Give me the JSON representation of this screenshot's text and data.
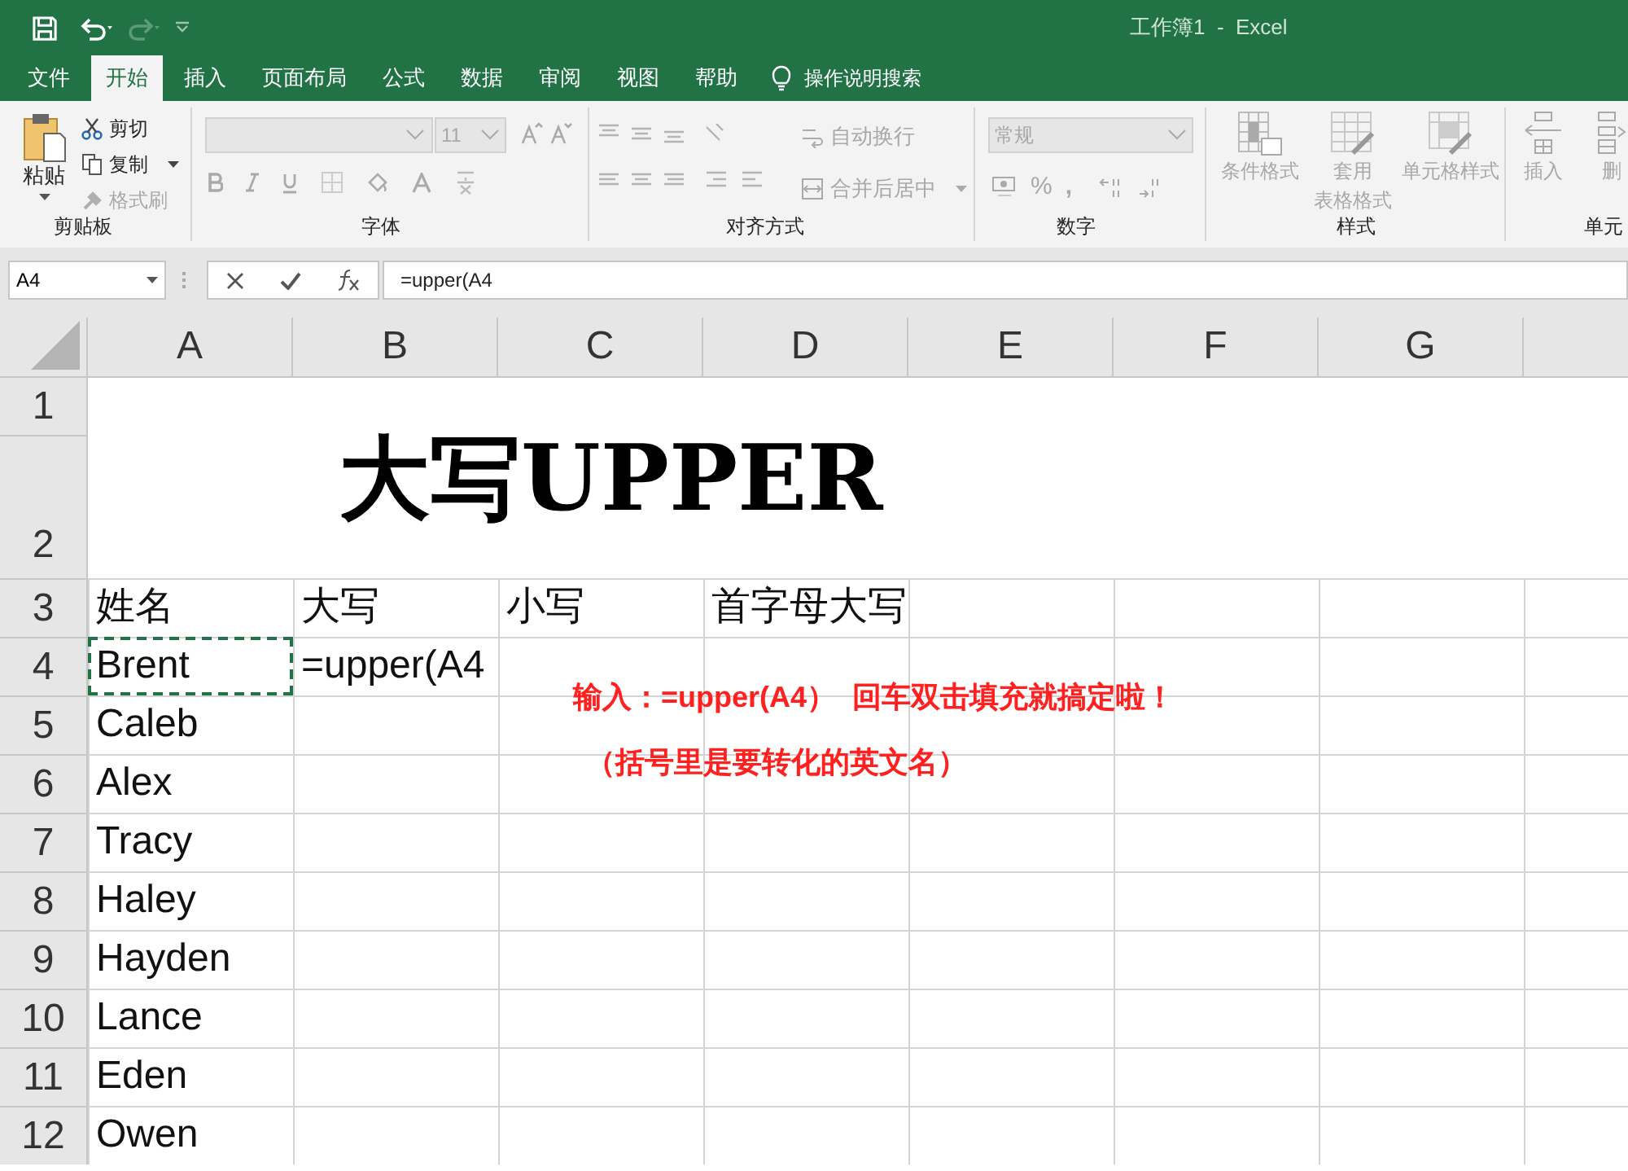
{
  "title_bar": {
    "title": "工作簿1  -  Excel"
  },
  "tabs": [
    {
      "label": "文件",
      "selected": false
    },
    {
      "label": "开始",
      "selected": true
    },
    {
      "label": "插入",
      "selected": false
    },
    {
      "label": "页面布局",
      "selected": false
    },
    {
      "label": "公式",
      "selected": false
    },
    {
      "label": "数据",
      "selected": false
    },
    {
      "label": "审阅",
      "selected": false
    },
    {
      "label": "视图",
      "selected": false
    },
    {
      "label": "帮助",
      "selected": false
    }
  ],
  "tell_me": "操作说明搜索",
  "ribbon": {
    "clipboard": {
      "paste": "粘贴",
      "cut": {
        "label": "剪切",
        "disabled": false
      },
      "copy": {
        "label": "复制",
        "disabled": false
      },
      "format_painter": {
        "label": "格式刷",
        "disabled": true
      },
      "group_label": "剪贴板"
    },
    "font": {
      "disabled": true,
      "font_size": "11",
      "group_label": "字体"
    },
    "alignment": {
      "disabled": true,
      "wrap_text": "自动换行",
      "merge_center": "合并后居中",
      "group_label": "对齐方式"
    },
    "number": {
      "disabled": true,
      "format": "常规",
      "percent": "%",
      "comma": ",",
      "group_label": "数字"
    },
    "styles": {
      "disabled": true,
      "conditional_formatting": "条件格式",
      "format_as_table_1": "套用",
      "format_as_table_2": "表格格式",
      "cell_styles": "单元格样式",
      "group_label": "样式"
    },
    "cells": {
      "disabled": true,
      "insert": "插入",
      "delete": "删",
      "group_label": "单元"
    }
  },
  "formula_bar": {
    "name_box": "A4",
    "formula": "=upper(A4"
  },
  "sheet": {
    "columns": [
      "A",
      "B",
      "C",
      "D",
      "E",
      "F",
      "G"
    ],
    "title": "大写UPPER",
    "row_numbers_merged": [
      "1",
      "2"
    ],
    "rows": [
      {
        "number": "3",
        "cells": [
          {
            "text": "姓名",
            "marquee": false
          },
          {
            "text": "大写",
            "marquee": false
          },
          {
            "text": "小写",
            "marquee": false
          },
          {
            "text": "首字母大写",
            "marquee": false
          }
        ]
      },
      {
        "number": "4",
        "cells": [
          {
            "text": "Brent",
            "marquee": true
          },
          {
            "text": "=upper(A4",
            "marquee": false
          }
        ]
      },
      {
        "number": "5",
        "cells": [
          {
            "text": "Caleb",
            "marquee": false
          }
        ]
      },
      {
        "number": "6",
        "cells": [
          {
            "text": "Alex",
            "marquee": false
          }
        ]
      },
      {
        "number": "7",
        "cells": [
          {
            "text": "Tracy",
            "marquee": false
          }
        ]
      },
      {
        "number": "8",
        "cells": [
          {
            "text": "Haley",
            "marquee": false
          }
        ]
      },
      {
        "number": "9",
        "cells": [
          {
            "text": "Hayden",
            "marquee": false
          }
        ]
      },
      {
        "number": "10",
        "cells": [
          {
            "text": "Lance",
            "marquee": false
          }
        ]
      },
      {
        "number": "11",
        "cells": [
          {
            "text": "Eden",
            "marquee": false
          }
        ]
      },
      {
        "number": "12",
        "cells": [
          {
            "text": "Owen",
            "marquee": false
          }
        ]
      }
    ],
    "annotations": [
      "输入：=upper(A4）  回车双击填充就搞定啦！",
      "（括号里是要转化的英文名）"
    ]
  }
}
